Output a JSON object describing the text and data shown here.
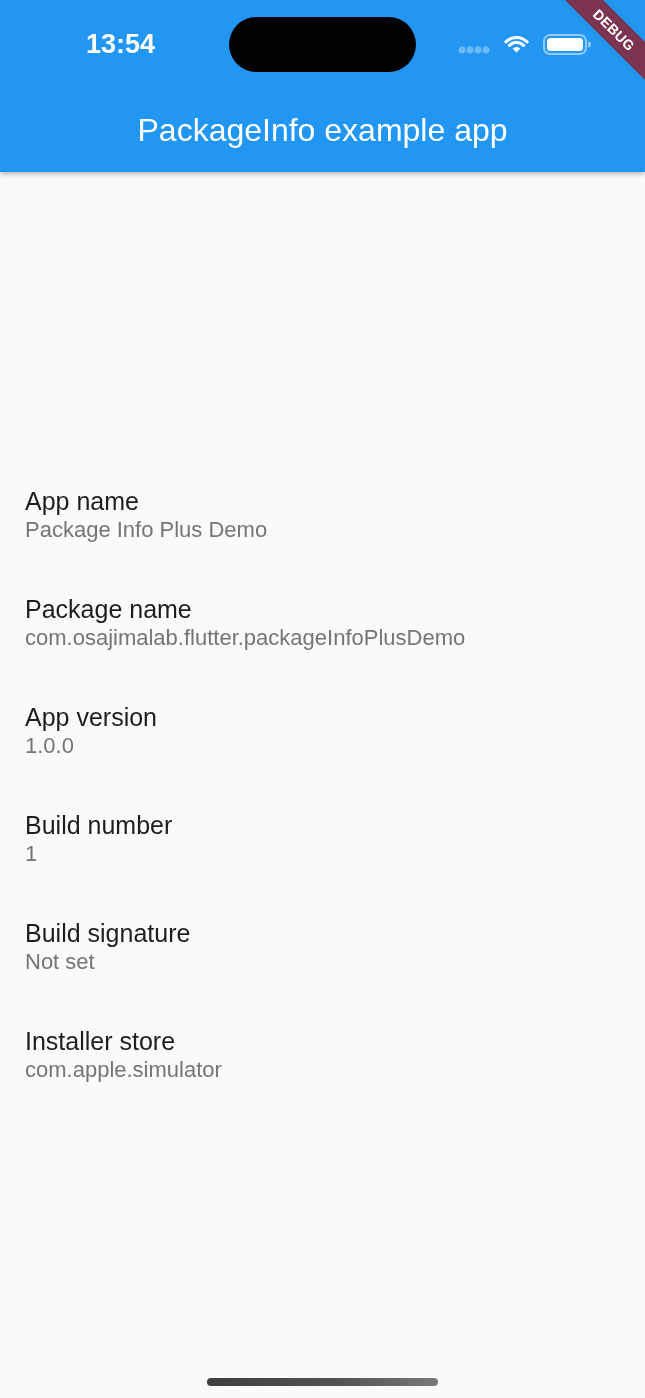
{
  "status_bar": {
    "time": "13:54"
  },
  "debug_banner": {
    "label": "DEBUG"
  },
  "app_bar": {
    "title": "PackageInfo example app"
  },
  "info_items": [
    {
      "title": "App name",
      "value": "Package Info Plus Demo"
    },
    {
      "title": "Package name",
      "value": "com.osajimalab.flutter.packageInfoPlusDemo"
    },
    {
      "title": "App version",
      "value": "1.0.0"
    },
    {
      "title": "Build number",
      "value": "1"
    },
    {
      "title": "Build signature",
      "value": "Not set"
    },
    {
      "title": "Installer store",
      "value": "com.apple.simulator"
    }
  ]
}
